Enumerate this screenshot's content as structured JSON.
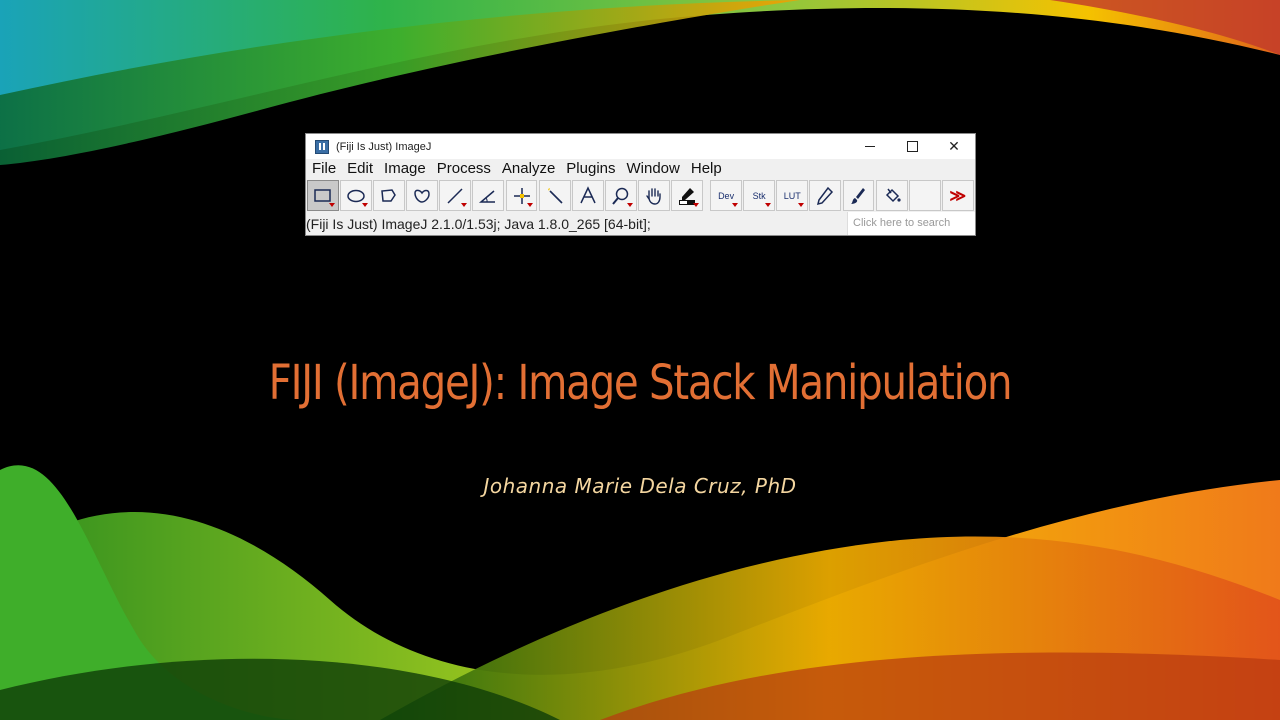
{
  "window": {
    "title": "(Fiji Is Just) ImageJ",
    "controls": {
      "minimize": "—",
      "maximize": "☐",
      "close": "✕"
    }
  },
  "menu": [
    "File",
    "Edit",
    "Image",
    "Process",
    "Analyze",
    "Plugins",
    "Window",
    "Help"
  ],
  "toolbar": {
    "dev_label": "Dev",
    "stk_label": "Stk",
    "lut_label": "LUT",
    "more_label": "≫"
  },
  "status": {
    "text": "(Fiji Is Just) ImageJ 2.1.0/1.53j; Java 1.8.0_265 [64-bit];",
    "search_placeholder": "Click here to search"
  },
  "slide": {
    "title": "FIJI (ImageJ): Image Stack Manipulation",
    "author": "Johanna Marie Dela Cruz, PhD"
  },
  "colors": {
    "title": "#e26f34",
    "author": "#f4d6a0",
    "background": "#000000",
    "swoosh_green": "#3fae2a",
    "swoosh_orange": "#f07a1a",
    "swoosh_yellow": "#f5c200"
  }
}
